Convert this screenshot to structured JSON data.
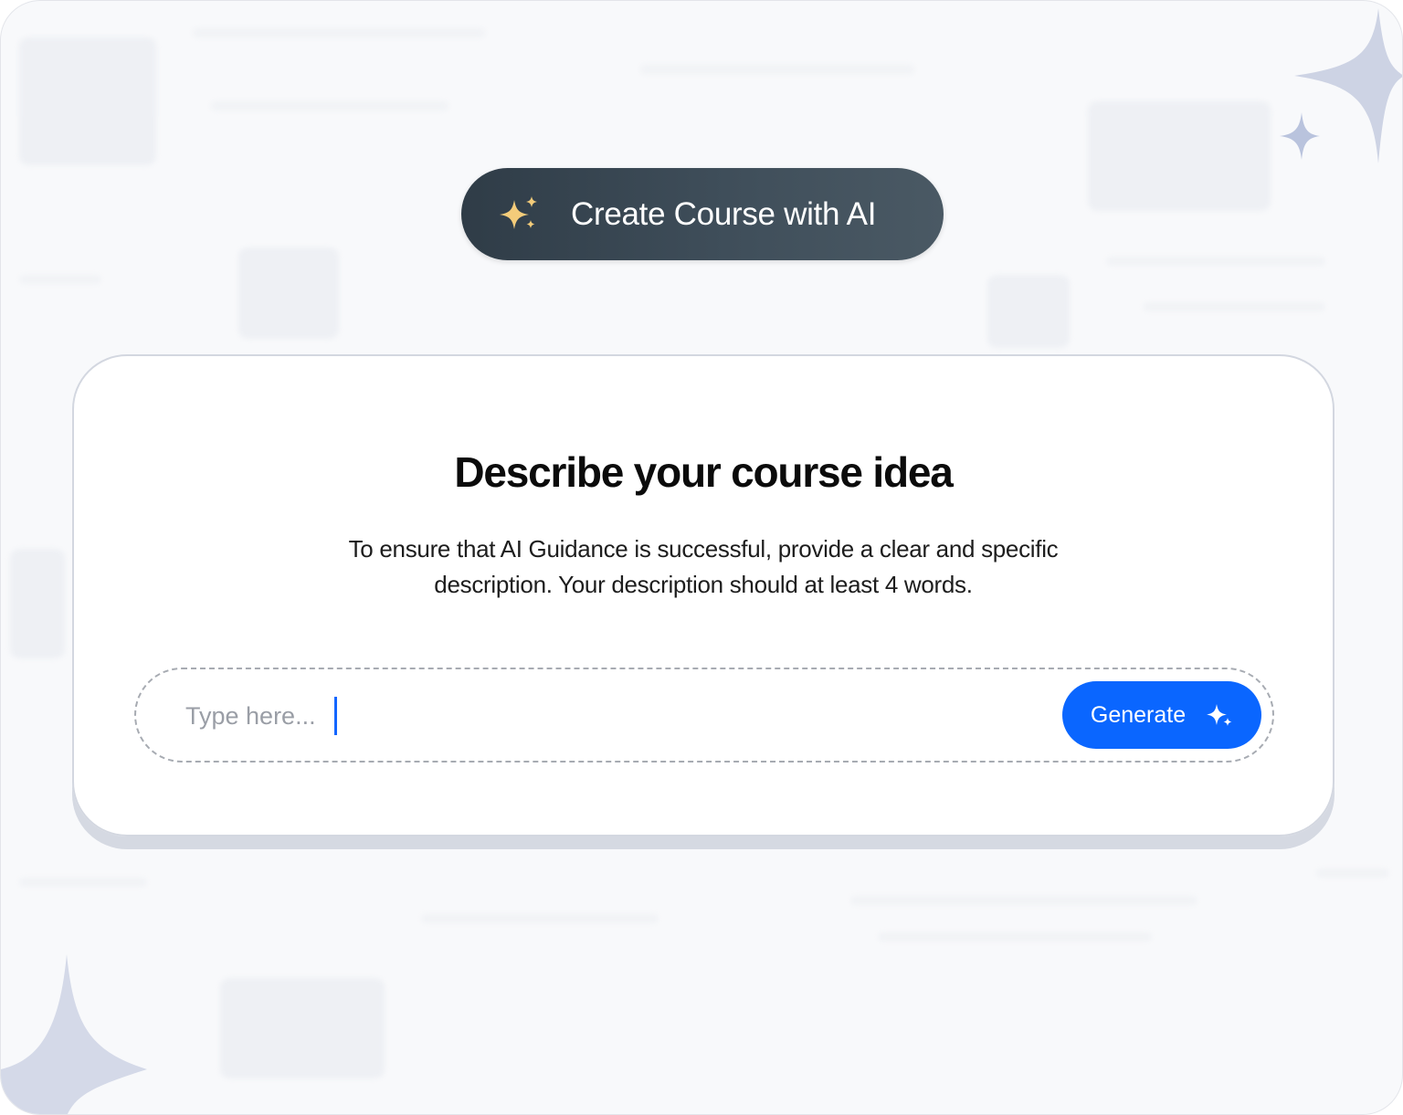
{
  "header": {
    "pill_label": "Create Course with AI",
    "pill_icon": "sparkles-icon"
  },
  "card": {
    "title": "Describe your course idea",
    "description": "To ensure that AI Guidance is successful, provide a clear and specific description. Your description should at least 4 words.",
    "input": {
      "value": "",
      "placeholder": "Type here..."
    },
    "generate_button": {
      "label": "Generate",
      "icon": "sparkles-icon"
    }
  },
  "colors": {
    "accent": "#0a66ff",
    "pill_bg": "#3a4955",
    "sparkle_gold": "#f4cc7a",
    "decor_star": "#c9d0e3"
  }
}
